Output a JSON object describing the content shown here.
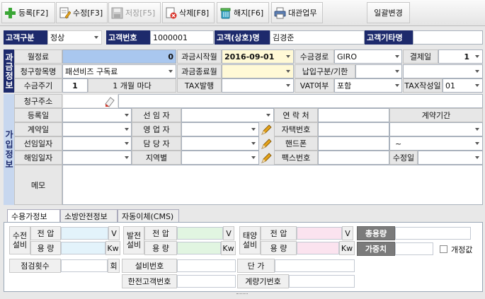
{
  "toolbar": {
    "register": "등록[F2]",
    "edit": "수정[F3]",
    "save": "저장[F5]",
    "delete": "삭제[F8]",
    "cancel": "해지[F6]",
    "print": "대관업무",
    "bulk": "일괄변경"
  },
  "header": {
    "cust_type_label": "고객구분",
    "cust_type_value": "정상",
    "cust_no_label": "고객번호",
    "cust_no_value": "1000001",
    "cust_name_label": "고객(상호)명",
    "cust_name_value": "김경준",
    "cust_other_label": "고객기타명",
    "cust_other_value": ""
  },
  "billing": {
    "side_label": "과금정보",
    "monthly_fee_label": "월정료",
    "monthly_fee_value": "0",
    "bill_start_label": "과금시작월",
    "bill_start_value": "2016-09-01",
    "collect_route_label": "수금경로",
    "collect_route_value": "GIRO",
    "pay_day_label": "결제일",
    "pay_day_value": "1",
    "bill_item_label": "청구항목명",
    "bill_item_value": "패션비즈 구독료",
    "bill_end_label": "과금종료월",
    "bill_end_value": "",
    "pay_type_label": "납입구분/기한",
    "pay_type_value": "",
    "pay_deadline_value": "",
    "cycle_label": "수금주기",
    "cycle_value": "1",
    "cycle_unit": "1 개월 마다",
    "tax_issue_label": "TAX발행",
    "tax_issue_value": "",
    "vat_label": "VAT여부",
    "vat_value": "포함",
    "tax_date_label": "TAX작성일",
    "tax_date_value": "01"
  },
  "join": {
    "side_label": "가입정보",
    "bill_addr_label": "청구주소",
    "bill_addr_value": "",
    "reg_date_label": "등록일",
    "reg_date_value": "",
    "prev_person_label": "선 임 자",
    "prev_person_value": "",
    "contact_label": "연 락 처",
    "contact_value": "",
    "contract_period_label": "계약기간",
    "contract_date_label": "계약일",
    "contract_date_value": "",
    "sales_label": "영 업 자",
    "sales_value": "",
    "home_phone_label": "자택번호",
    "home_phone_value": "",
    "prev_date_label": "선임일자",
    "prev_date_value": "",
    "manager_label": "담 당 자",
    "manager_value": "",
    "mobile_label": "핸드폰",
    "mobile_value": "",
    "period_sep": "~",
    "cancel_date_label": "해임일자",
    "cancel_date_value": "",
    "region_label": "지역별",
    "region_value": "",
    "fax_label": "팩스번호",
    "fax_value": "",
    "renew_label": "수정일",
    "renew_value": "",
    "memo_label": "메모",
    "memo_value": ""
  },
  "tabs": [
    "수용가정보",
    "소방안전정보",
    "자동이체(CMS)"
  ],
  "receiver": {
    "power_rx_label": "수전\n설비",
    "dev_label": "발전\n설비",
    "solar_label": "태양\n설비",
    "voltage_label": "전 압",
    "capacity_label": "용 량",
    "unit_v": "V",
    "unit_kw": "Kw",
    "total_cap_label": "총용량",
    "weight_label": "가중치",
    "revised_label": "개정값",
    "inspect_label": "점검횟수",
    "inspect_unit": "회",
    "equip_no_label": "설비번호",
    "unit_price_label": "단 가",
    "kepco_no_label": "한전고객번호",
    "meter_no_label": "계량기번호"
  }
}
